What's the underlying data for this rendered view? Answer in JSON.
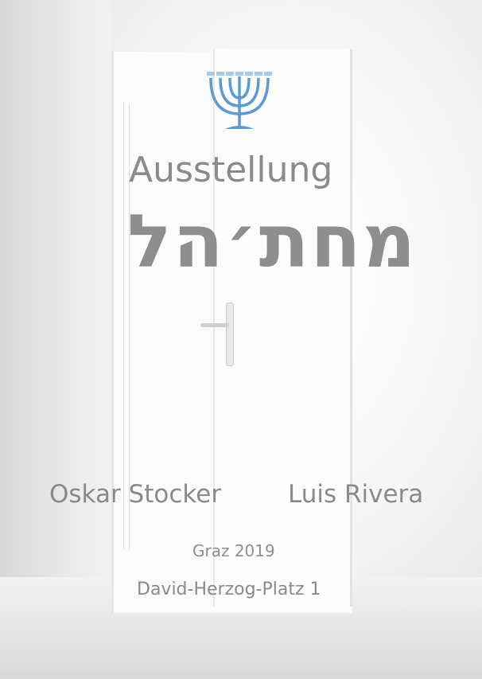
{
  "poster": {
    "title": "Ausstellung",
    "hebrew_title": "מחת׳הל",
    "artists": [
      "Oskar Stocker",
      "Luis Rivera"
    ],
    "city_year": "Graz 2019",
    "address": "David-Herzog-Platz 1",
    "icon": "menorah-icon",
    "accent_color": "#5b9bd5"
  }
}
